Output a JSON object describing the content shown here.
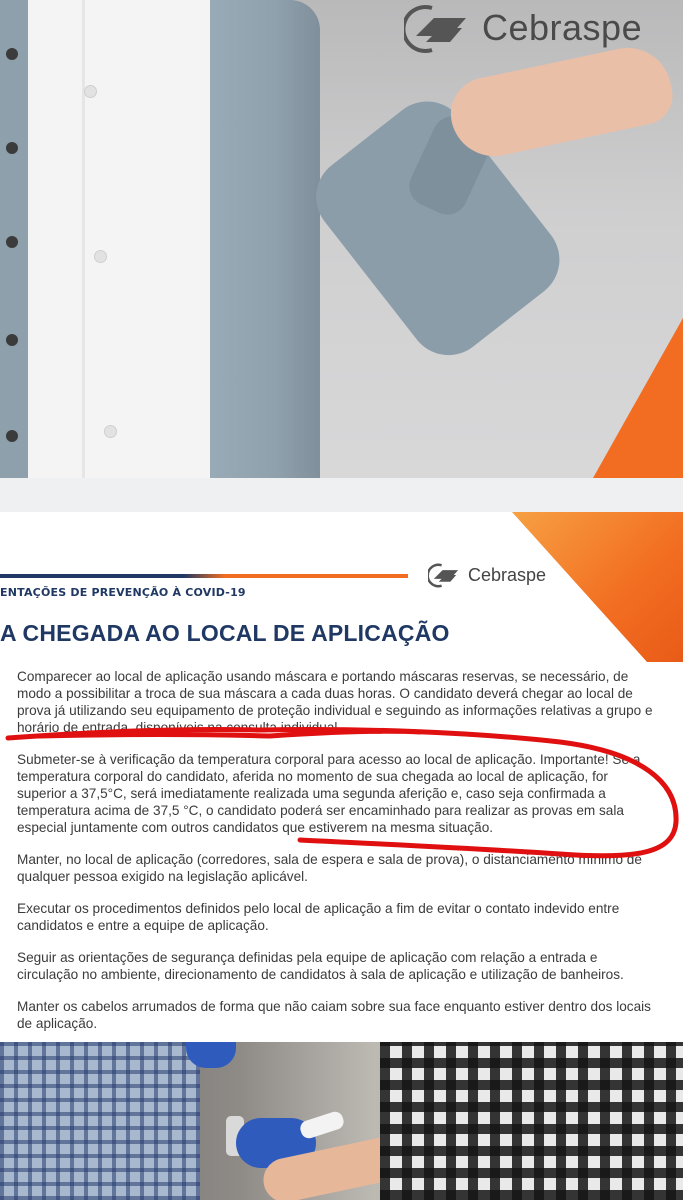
{
  "hero": {
    "brand": "Cebraspe",
    "logo_icon": "cebraspe-logo-icon",
    "photo": "woman-in-grey-cardigan-presenting"
  },
  "slide": {
    "brand": "Cebraspe",
    "subtitle": "ENTAÇÕES DE PREVENÇÃO À COVID-19",
    "heading": "A CHEGADA AO LOCAL DE APLICAÇÃO",
    "items": [
      "Comparecer ao local de aplicação usando máscara e portando máscaras reservas, se necessário, de modo a possibilitar a troca de sua máscara a cada duas horas. O candidato deverá chegar ao local de prova já utilizando seu equipamento de proteção individual e seguindo as informações relativas a grupo e horário de entrada, disponíveis na consulta individual.",
      "Submeter-se à verificação da temperatura corporal para acesso ao local de aplicação. Importante! Se a temperatura corporal do candidato, aferida no momento de sua chegada ao local de aplicação, for superior a 37,5°C, será imediatamente realizada uma segunda aferição e, caso seja confirmada a temperatura acima de 37,5 °C, o candidato poderá ser encaminhado para realizar as provas em sala especial juntamente com outros candidatos que estiverem na mesma situação.",
      "Manter, no local de aplicação (corredores, sala de espera e sala de prova), o distanciamento mínimo de qualquer pessoa exigido na legislação aplicável.",
      "Executar os procedimentos definidos pelo local de aplicação a fim de evitar o contato indevido entre candidatos e entre a equipe de aplicação.",
      "Seguir as orientações de segurança definidas pela equipe de aplicação com relação a entrada e circulação no ambiente, direcionamento de candidatos à sala de aplicação e utilização de banheiros.",
      "Manter os cabelos arrumados de forma que não caiam sobre sua face enquanto estiver dentro dos locais de aplicação."
    ],
    "colors": {
      "navy": "#1f3864",
      "orange": "#f26d21",
      "annotation": "#e01010"
    }
  },
  "bottom": {
    "photo": "temperature-check-with-gloved-hand"
  }
}
